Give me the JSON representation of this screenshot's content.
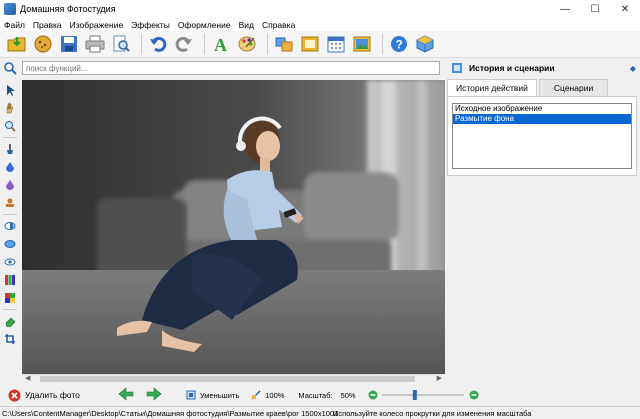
{
  "window": {
    "title": "Домашняя Фотостудия",
    "minimize": "—",
    "maximize": "☐",
    "close": "✕"
  },
  "menu": [
    "Файл",
    "Правка",
    "Изображение",
    "Эффекты",
    "Оформление",
    "Вид",
    "Справка"
  ],
  "search": {
    "placeholder": "поиск функций..."
  },
  "panel": {
    "title": "История и сценарии",
    "tabs": [
      "История действий",
      "Сценарии"
    ],
    "history": [
      "Исходное изображение",
      "Размытие фона"
    ],
    "selected_index": 1
  },
  "bottom": {
    "delete_label": "Удалить фото",
    "shrink_label": "Уменьшить",
    "zoom_percent": "100%",
    "scale_label": "Масштаб:",
    "scale_value": "50%"
  },
  "zoom_slider_level": 0.4,
  "status": {
    "path": "C:\\Users\\ContentManager\\Desktop\\Статьи\\Домашняя фотостудия\\Размытие краев\\рог 1500x1001",
    "hint": "Используйте колесо прокрутки для изменения масштаба"
  },
  "colors": {
    "accent": "#0a66d0",
    "green": "#34a853",
    "red": "#d93025"
  }
}
